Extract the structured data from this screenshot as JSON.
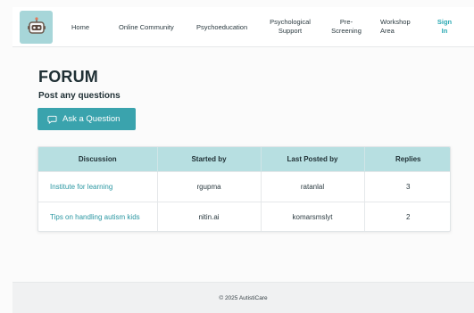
{
  "nav": {
    "items": [
      {
        "label": "Home"
      },
      {
        "label": "Online Community"
      },
      {
        "label": "Psychoeducation"
      },
      {
        "label": "Psychological Support"
      },
      {
        "label": "Pre-Screening"
      },
      {
        "label": "Workshop Area"
      },
      {
        "label": "Sign In"
      }
    ],
    "logo_icon": "robot-logo-icon"
  },
  "page": {
    "title": "FORUM",
    "subtitle": "Post any questions",
    "ask_button_label": "Ask a Question",
    "ask_button_icon": "chat-bubble-icon"
  },
  "table": {
    "headers": [
      "Discussion",
      "Started by",
      "Last Posted by",
      "Replies"
    ],
    "rows": [
      {
        "discussion": "Institute for learning",
        "started_by": "rgupma",
        "last_posted_by": "ratanlal",
        "replies": "3"
      },
      {
        "discussion": "Tips on handling autism kids",
        "started_by": "nitin.ai",
        "last_posted_by": "komarsmslyt",
        "replies": "2"
      }
    ]
  },
  "footer": {
    "text": "© 2025 AutistiCare"
  },
  "colors": {
    "accent": "#3aa3ad",
    "header_bg": "#b7dfe1",
    "link": "#2b97a2"
  }
}
